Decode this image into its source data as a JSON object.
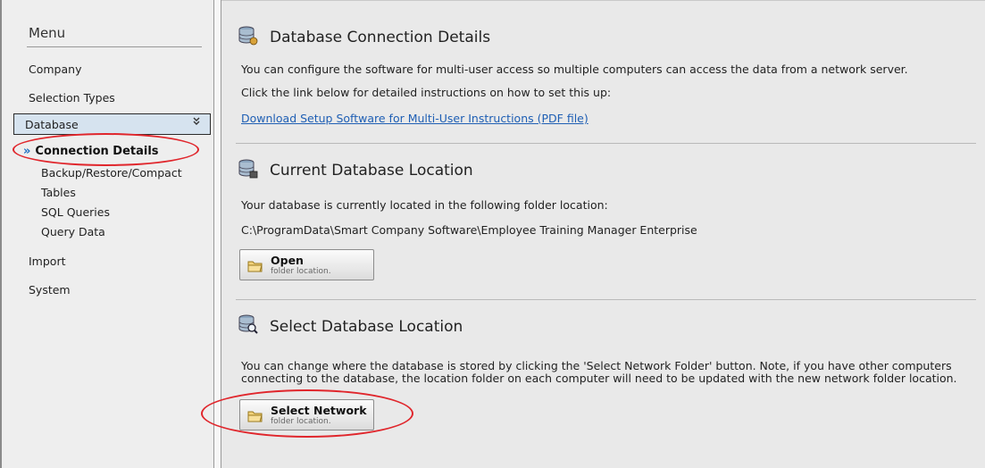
{
  "menu": {
    "title": "Menu",
    "items": [
      {
        "label": "Company"
      },
      {
        "label": "Selection Types"
      },
      {
        "label": "Database",
        "expanded": true
      },
      {
        "label": "Import"
      },
      {
        "label": "System"
      }
    ],
    "database_subitems": [
      {
        "label": "Connection Details",
        "active": true
      },
      {
        "label": "Backup/Restore/Compact"
      },
      {
        "label": "Tables"
      },
      {
        "label": "SQL Queries"
      },
      {
        "label": "Query Data"
      }
    ],
    "active_marker": "»",
    "expand_glyph": "»"
  },
  "sections": {
    "connection": {
      "title": "Database Connection Details",
      "icon": "database-connection-icon",
      "line1": "You can configure the software for multi-user access so multiple computers can access the data from a network server.",
      "line2": "Click the link below for detailed instructions on how to set this up:",
      "link": "Download Setup Software for Multi-User Instructions (PDF file)"
    },
    "current": {
      "title": "Current Database Location",
      "icon": "database-location-icon",
      "line1": "Your database is currently located in the following folder location:",
      "path": "C:\\ProgramData\\Smart Company Software\\Employee Training Manager Enterprise",
      "button": {
        "title": "Open",
        "subtitle": "folder location.",
        "icon": "folder-icon"
      }
    },
    "select": {
      "title": "Select Database Location",
      "icon": "database-search-icon",
      "line1": "You can change where the database is stored by clicking the 'Select Network Folder' button. Note, if you have other computers",
      "line2": "connecting to the database, the location folder on each computer will need to be updated with the new network folder location.",
      "button": {
        "title": "Select Network",
        "subtitle": "folder location.",
        "icon": "folder-icon"
      }
    }
  },
  "colors": {
    "accent_link": "#1f5fb4",
    "highlight_ellipse": "#e0262c",
    "selected_menu_bg": "#d6e3ef"
  }
}
